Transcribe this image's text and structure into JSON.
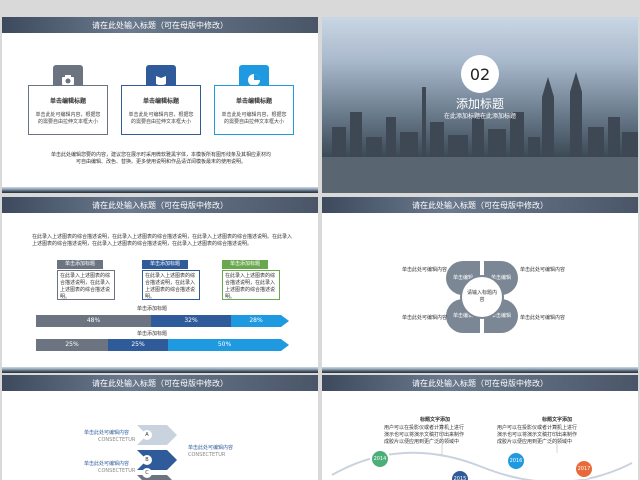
{
  "slide1": {
    "header": "请在此处输入标题（可在母版中修改）",
    "cards": [
      {
        "title": "单击编辑标题",
        "desc": "单击此处可编辑内容，根据您的需要自由拉伸文本框大小",
        "color": "#6b7480"
      },
      {
        "title": "单击编辑标题",
        "desc": "单击此处可编辑内容，根据您的需要自由拉伸文本框大小",
        "color": "#2f5b9a"
      },
      {
        "title": "单击编辑标题",
        "desc": "单击此处可编辑内容，根据您的需要自由拉伸文本框大小",
        "color": "#1f9ae0"
      }
    ],
    "footer": "单击此处编辑您要的内容，建议您在展示时采用微软雅黑字体，本模板所有图形线条及其相应素材均可自由编辑、改色、替换。更多使用说明和作品请详阅模板最末的使用说明。"
  },
  "slide2": {
    "number": "02",
    "title": "添加标题",
    "subtitle": "在此添加标题在此添加标题"
  },
  "slide3": {
    "header": "请在此处输入标题（可在母版中修改）",
    "intro": "在此录入上述图表的综合描述说明，在此录入上述图表的综合描述说明，在此录入上述图表的综合描述说明。在此录入上述图表的综合描述说明，在此录入上述图表的综合描述说明，在此录入上述图表的综合描述说明。",
    "boxes": [
      {
        "tag": "单击添加标题",
        "text": "在此录入上述图表的综合描述说明，在此录入上述图表的综合描述说明。",
        "color": "#6b7480"
      },
      {
        "tag": "单击添加标题",
        "text": "在此录入上述图表的综合描述说明，在此录入上述图表的综合描述说明。",
        "color": "#2f5b9a"
      },
      {
        "tag": "单击添加标题",
        "text": "在此录入上述图表的综合描述说明，在此录入上述图表的综合描述说明。",
        "color": "#6aa84f"
      }
    ],
    "bar1_label": "单击添加标题",
    "bar1": [
      "48%",
      "32%",
      "28%"
    ],
    "bar2_label": "单击添加标题",
    "bar2": [
      "25%",
      "25%",
      "50%"
    ]
  },
  "slide4": {
    "header": "请在此处输入标题（可在母版中修改）",
    "center": "请输入标题内容",
    "petals": [
      "单击编辑",
      "单击编辑",
      "单击编辑",
      "单击编辑"
    ],
    "labels": [
      "单击此处可编辑内容",
      "单击此处可编辑内容",
      "单击此处可编辑内容",
      "单击此处可编辑内容"
    ]
  },
  "slide5": {
    "header": "请在此处输入标题（可在母版中修改）",
    "left1": "单击此处可编辑内容",
    "left1_sub": "CONSECTETUR",
    "right1": "单击此处可编辑内容",
    "right1_sub": "CONSECTETUR",
    "left2": "单击此处可编辑内容",
    "left2_sub": "CONSECTETUR",
    "letters": [
      "A",
      "B",
      "C"
    ]
  },
  "slide6": {
    "header": "请在此处输入标题（可在母版中修改）",
    "t1_title": "标题文字添加",
    "t1_text": "用户可以在投影仪或者计算机上进行演示也可以将演示文稿打印出来制作成胶片以便应用到更广泛的领域中",
    "t2_title": "标题文字添加",
    "t2_text": "用户可以在投影仪或者计算机上进行演示也可以将演示文稿打印出来制作成胶片以便应用到更广泛的领域中",
    "years": [
      "2014",
      "2015",
      "2016",
      "2017"
    ],
    "year_colors": [
      "#4caf7a",
      "#2f5b9a",
      "#1f9ae0",
      "#e86a3a"
    ]
  }
}
